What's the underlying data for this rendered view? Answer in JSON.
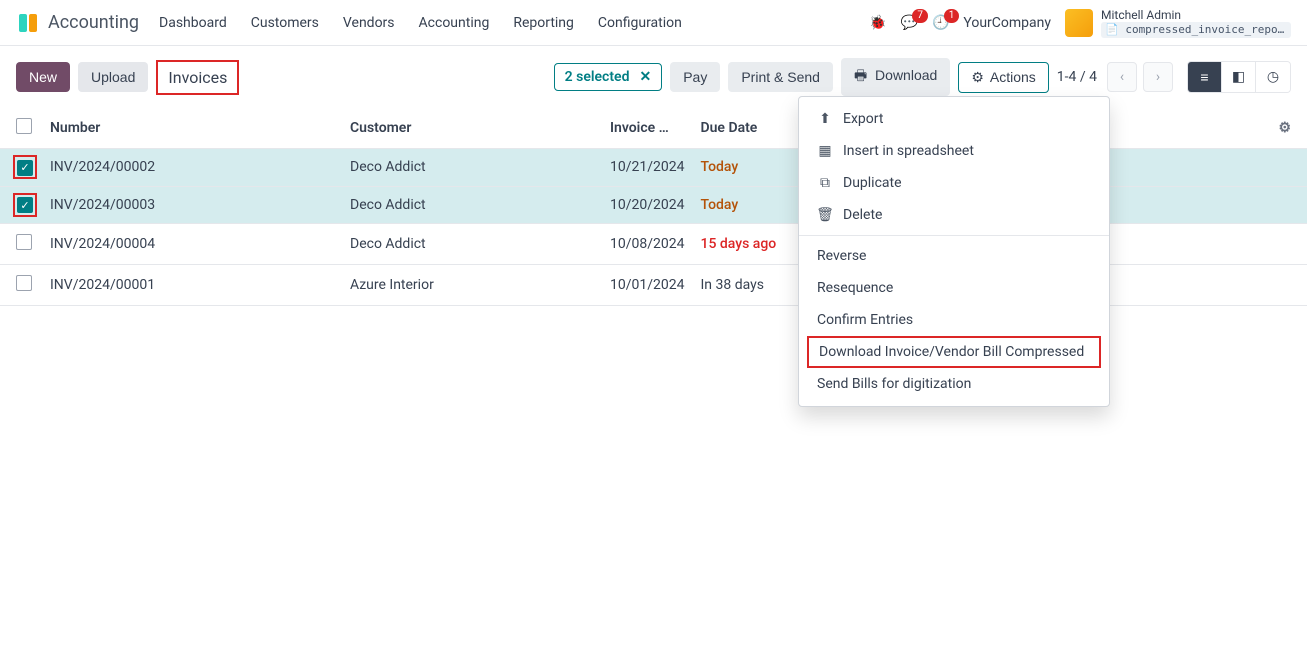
{
  "app_name": "Accounting",
  "nav": [
    "Dashboard",
    "Customers",
    "Vendors",
    "Accounting",
    "Reporting",
    "Configuration"
  ],
  "msg_badge": "7",
  "act_badge": "1",
  "company": "YourCompany",
  "user_name": "Mitchell Admin",
  "db_name": "📄 compressed_invoice_repor…",
  "btn_new": "New",
  "btn_upload": "Upload",
  "crumb": "Invoices",
  "selected_text": "2 selected",
  "btn_pay": "Pay",
  "btn_print": "Print & Send",
  "btn_download": "Download",
  "btn_actions": "Actions",
  "pager": "1-4 / 4",
  "columns": {
    "number": "Number",
    "customer": "Customer",
    "invoice": "Invoice …",
    "due": "Due Date"
  },
  "rows": [
    {
      "checked": true,
      "number": "INV/2024/00002",
      "customer": "Deco Addict",
      "invoice": "10/21/2024",
      "due": "Today",
      "due_cls": "due-today"
    },
    {
      "checked": true,
      "number": "INV/2024/00003",
      "customer": "Deco Addict",
      "invoice": "10/20/2024",
      "due": "Today",
      "due_cls": "due-today"
    },
    {
      "checked": false,
      "number": "INV/2024/00004",
      "customer": "Deco Addict",
      "invoice": "10/08/2024",
      "due": "15 days ago",
      "due_cls": "due-overdue"
    },
    {
      "checked": false,
      "number": "INV/2024/00001",
      "customer": "Azure Interior",
      "invoice": "10/01/2024",
      "due": "In 38 days",
      "due_cls": ""
    }
  ],
  "dropdown": {
    "export": "Export",
    "insert": "Insert in spreadsheet",
    "duplicate": "Duplicate",
    "delete": "Delete",
    "reverse": "Reverse",
    "resequence": "Resequence",
    "confirm": "Confirm Entries",
    "dl_compressed": "Download Invoice/Vendor Bill Compressed",
    "digitize": "Send Bills for digitization"
  }
}
